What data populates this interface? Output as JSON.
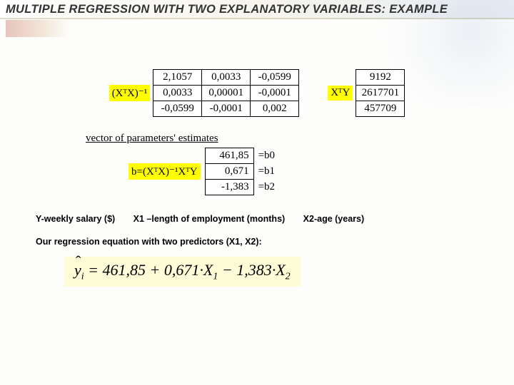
{
  "title": "MULTIPLE REGRESSION WITH TWO EXPLANATORY VARIABLES: EXAMPLE",
  "xtx_inv": {
    "label": "(XᵀX)⁻¹",
    "rows": [
      [
        "2,1057",
        "0,0033",
        "-0,0599"
      ],
      [
        "0,0033",
        "0,00001",
        "-0,0001"
      ],
      [
        "-0,0599",
        "-0,0001",
        "0,002"
      ]
    ]
  },
  "xty": {
    "label": "XᵀY",
    "rows": [
      [
        "9192"
      ],
      [
        "2617701"
      ],
      [
        "457709"
      ]
    ]
  },
  "vec_caption": "vector of parameters' estimates",
  "b": {
    "label": "b=(XᵀX)⁻¹XᵀY",
    "rows": [
      {
        "coef": "461,85",
        "lab": "=b0"
      },
      {
        "coef": "0,671",
        "lab": "=b1"
      },
      {
        "coef": "-1,383",
        "lab": "=b2"
      }
    ]
  },
  "vars": {
    "y": "Y-weekly salary ($)",
    "x1": "X1 –length of employment (months)",
    "x2": "X2-age (years)"
  },
  "eq_caption": "Our regression equation with two predictors (X1, X2):",
  "equation": {
    "b0": "461,85",
    "b1": "0,671",
    "b2": "1,383"
  }
}
